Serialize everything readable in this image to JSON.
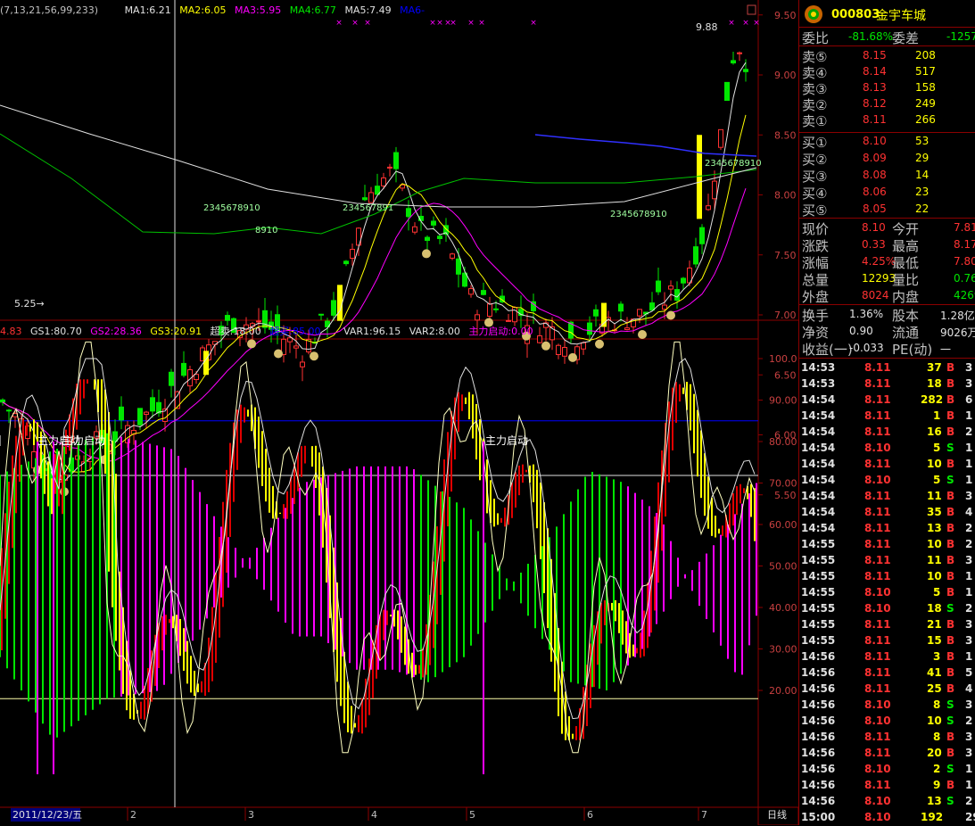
{
  "main_indicator": {
    "params": "(7,13,21,56,99,233)",
    "ma1": "MA1:6.21",
    "ma2": "MA2:6.05",
    "ma3": "MA3:5.95",
    "ma4": "MA4:6.77",
    "ma5": "MA5:7.49",
    "ma6": "MA6-"
  },
  "price_axis": [
    "9.50",
    "9.00",
    "8.50",
    "8.00",
    "7.50",
    "7.00",
    "6.50",
    "6.00",
    "5.50"
  ],
  "price_marks": {
    "high": "9.88",
    "low": "5.25"
  },
  "sub_indicator": {
    "v1": "4.83",
    "gs1": "GS1:80.70",
    "gs2": "GS2:28.36",
    "gs3": "GS3:20.91",
    "oversold": "超卖:18.00",
    "overbought": "超买:85.00",
    "var1": "VAR1:96.15",
    "var2": "VAR2:8.00",
    "start": "主力启动:0.00"
  },
  "sub_axis": [
    "100.0",
    "90.00",
    "80.00",
    "70.00",
    "60.00",
    "50.00",
    "40.00",
    "30.00",
    "20.00"
  ],
  "signals": [
    "主力启动",
    "主力启动",
    "主力启动"
  ],
  "seq_labels": [
    "234567891",
    "2345678910",
    "2345678910",
    "2345678910",
    "8910"
  ],
  "date_axis": {
    "current": "2011/12/23/五",
    "months": [
      "2",
      "3",
      "4",
      "5",
      "6",
      "7"
    ],
    "period": "日线"
  },
  "quote": {
    "code": "000803",
    "name": "金宇车城",
    "webi_label": "委比",
    "webi": "-81.68%",
    "weicha_label": "委差",
    "weicha": "-1257",
    "asks": [
      {
        "label": "卖⑤",
        "price": "8.15",
        "vol": "208"
      },
      {
        "label": "卖④",
        "price": "8.14",
        "vol": "517"
      },
      {
        "label": "卖③",
        "price": "8.13",
        "vol": "158"
      },
      {
        "label": "卖②",
        "price": "8.12",
        "vol": "249"
      },
      {
        "label": "卖①",
        "price": "8.11",
        "vol": "266"
      }
    ],
    "bids": [
      {
        "label": "买①",
        "price": "8.10",
        "vol": "53"
      },
      {
        "label": "买②",
        "price": "8.09",
        "vol": "29"
      },
      {
        "label": "买③",
        "price": "8.08",
        "vol": "14"
      },
      {
        "label": "买④",
        "price": "8.06",
        "vol": "23"
      },
      {
        "label": "买⑤",
        "price": "8.05",
        "vol": "22"
      }
    ],
    "stats": [
      {
        "l1": "现价",
        "v1": "8.10",
        "l2": "今开",
        "v2": "7.81"
      },
      {
        "l1": "涨跌",
        "v1": "0.33",
        "l2": "最高",
        "v2": "8.17"
      },
      {
        "l1": "涨幅",
        "v1": "4.25%",
        "l2": "最低",
        "v2": "7.80"
      },
      {
        "l1": "总量",
        "v1": "12293",
        "l2": "量比",
        "v2": "0.76"
      },
      {
        "l1": "外盘",
        "v1": "8024",
        "l2": "内盘",
        "v2": "4269"
      }
    ],
    "info": [
      {
        "l1": "换手",
        "v1": "1.36%",
        "l2": "股本",
        "v2": "1.28亿"
      },
      {
        "l1": "净资",
        "v1": "0.90",
        "l2": "流通",
        "v2": "9026万"
      },
      {
        "l1": "收益(一)",
        "v1": "-0.033",
        "l2": "PE(动)",
        "v2": "一"
      }
    ]
  },
  "ticks": [
    {
      "t": "14:53",
      "p": "8.11",
      "v": "37",
      "s": "B",
      "e": "3"
    },
    {
      "t": "14:53",
      "p": "8.11",
      "v": "18",
      "s": "B",
      "e": "3"
    },
    {
      "t": "14:54",
      "p": "8.11",
      "v": "282",
      "s": "B",
      "e": "6"
    },
    {
      "t": "14:54",
      "p": "8.11",
      "v": "1",
      "s": "B",
      "e": "1"
    },
    {
      "t": "14:54",
      "p": "8.11",
      "v": "16",
      "s": "B",
      "e": "2"
    },
    {
      "t": "14:54",
      "p": "8.10",
      "v": "5",
      "s": "S",
      "e": "1"
    },
    {
      "t": "14:54",
      "p": "8.11",
      "v": "10",
      "s": "B",
      "e": "1"
    },
    {
      "t": "14:54",
      "p": "8.10",
      "v": "5",
      "s": "S",
      "e": "1"
    },
    {
      "t": "14:54",
      "p": "8.11",
      "v": "11",
      "s": "B",
      "e": "3"
    },
    {
      "t": "14:54",
      "p": "8.11",
      "v": "35",
      "s": "B",
      "e": "4"
    },
    {
      "t": "14:54",
      "p": "8.11",
      "v": "13",
      "s": "B",
      "e": "2"
    },
    {
      "t": "14:55",
      "p": "8.11",
      "v": "10",
      "s": "B",
      "e": "2"
    },
    {
      "t": "14:55",
      "p": "8.11",
      "v": "11",
      "s": "B",
      "e": "3"
    },
    {
      "t": "14:55",
      "p": "8.11",
      "v": "10",
      "s": "B",
      "e": "1"
    },
    {
      "t": "14:55",
      "p": "8.10",
      "v": "5",
      "s": "B",
      "e": "1"
    },
    {
      "t": "14:55",
      "p": "8.10",
      "v": "18",
      "s": "S",
      "e": "2"
    },
    {
      "t": "14:55",
      "p": "8.11",
      "v": "21",
      "s": "B",
      "e": "3"
    },
    {
      "t": "14:55",
      "p": "8.11",
      "v": "15",
      "s": "B",
      "e": "3"
    },
    {
      "t": "14:56",
      "p": "8.11",
      "v": "3",
      "s": "B",
      "e": "1"
    },
    {
      "t": "14:56",
      "p": "8.11",
      "v": "41",
      "s": "B",
      "e": "5"
    },
    {
      "t": "14:56",
      "p": "8.11",
      "v": "25",
      "s": "B",
      "e": "4"
    },
    {
      "t": "14:56",
      "p": "8.10",
      "v": "8",
      "s": "S",
      "e": "3"
    },
    {
      "t": "14:56",
      "p": "8.10",
      "v": "10",
      "s": "S",
      "e": "2"
    },
    {
      "t": "14:56",
      "p": "8.11",
      "v": "8",
      "s": "B",
      "e": "3"
    },
    {
      "t": "14:56",
      "p": "8.11",
      "v": "20",
      "s": "B",
      "e": "3"
    },
    {
      "t": "14:56",
      "p": "8.10",
      "v": "2",
      "s": "S",
      "e": "1"
    },
    {
      "t": "14:56",
      "p": "8.11",
      "v": "9",
      "s": "B",
      "e": "1"
    },
    {
      "t": "14:56",
      "p": "8.10",
      "v": "13",
      "s": "S",
      "e": "2"
    },
    {
      "t": "15:00",
      "p": "8.10",
      "v": "192",
      "s": "",
      "e": "29"
    }
  ],
  "colors": {
    "up": "#ff3232",
    "down": "#00e600",
    "yellow": "#ffff00",
    "magenta": "#ff00ff",
    "grid": "#8b0000",
    "blue": "#0000ff"
  }
}
